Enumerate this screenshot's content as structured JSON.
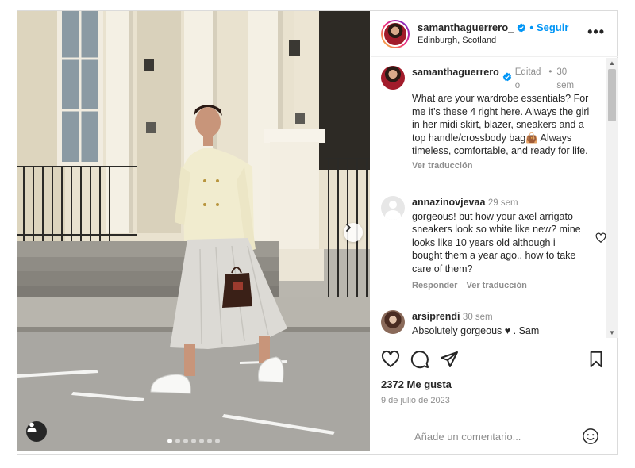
{
  "post": {
    "author": "samanthaguerrero_",
    "follow_label": "Seguir",
    "separator": "•",
    "location": "Edinburgh, Scotland",
    "more_label": "•••",
    "carousel": {
      "slides": 7,
      "active": 0
    }
  },
  "caption": {
    "author_line1": "samanthaguerrero",
    "author_line2": "_",
    "edited_line1": "Editad",
    "edited_line2": "o",
    "dot": "•",
    "time_line1": "30",
    "time_line2": "sem",
    "text": "What are your wardrobe essentials? For me it's these 4 right here. Always the girl in her midi skirt, blazer, sneakers and a top handle/crossbody bag👜 Always timeless, comfortable, and ready for life.",
    "translate": "Ver traducción"
  },
  "comments": [
    {
      "user": "annazinovjevaa",
      "time": "29 sem",
      "text": "gorgeous! but how your axel arrigato sneakers look so white like new? mine looks like 10 years old although i bought them a year ago.. how to take care of them?",
      "reply": "Responder",
      "translate": "Ver traducción"
    },
    {
      "user": "arsiprendi",
      "time": "30 sem",
      "text": "Absolutely gorgeous ♥ . Sam"
    }
  ],
  "scroll": {
    "up": "▲",
    "down": "▼"
  },
  "stats": {
    "likes": "2372 Me gusta",
    "date": "9 de julio de 2023"
  },
  "compose": {
    "placeholder": "Añade un comentario..."
  },
  "icons": {
    "like": "heart-icon",
    "comment": "comment-icon",
    "share": "paper-plane-icon",
    "save": "bookmark-icon",
    "next": "chevron-right-icon",
    "tag": "user-tag-icon",
    "emoji": "emoji-icon",
    "verified": "verified-badge-icon"
  },
  "colors": {
    "accent": "#0095f6",
    "verified": "#0095f6",
    "muted": "#8e8e8e",
    "text": "#262626"
  }
}
